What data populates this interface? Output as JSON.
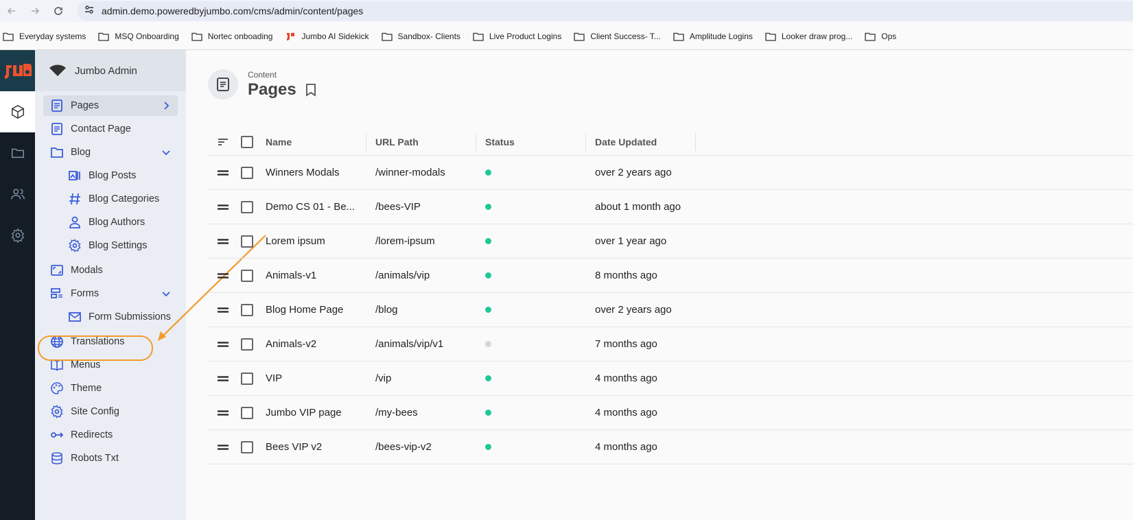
{
  "browser": {
    "url": "admin.demo.poweredbyjumbo.com/cms/admin/content/pages",
    "bookmarks": [
      {
        "label": "Everyday systems",
        "icon": "folder-icon"
      },
      {
        "label": "MSQ Onboarding",
        "icon": "folder-icon"
      },
      {
        "label": "Nortec onboading",
        "icon": "folder-icon"
      },
      {
        "label": "Jumbo AI Sidekick",
        "icon": "jumbo-logo-icon"
      },
      {
        "label": "Sandbox- Clients",
        "icon": "folder-icon"
      },
      {
        "label": "Live Product Logins",
        "icon": "folder-icon"
      },
      {
        "label": "Client Success- T...",
        "icon": "folder-icon"
      },
      {
        "label": "Amplitude Logins",
        "icon": "folder-icon"
      },
      {
        "label": "Looker draw prog...",
        "icon": "folder-icon"
      },
      {
        "label": "Ops",
        "icon": "folder-icon"
      }
    ]
  },
  "sidebar": {
    "workspace": "Jumbo Admin",
    "items": {
      "pages": "Pages",
      "contact": "Contact Page",
      "blog": "Blog",
      "blog_posts": "Blog Posts",
      "blog_categories": "Blog Categories",
      "blog_authors": "Blog Authors",
      "blog_settings": "Blog Settings",
      "modals": "Modals",
      "forms": "Forms",
      "form_submissions": "Form Submissions",
      "translations": "Translations",
      "menus": "Menus",
      "theme": "Theme",
      "site_config": "Site Config",
      "redirects": "Redirects",
      "robots": "Robots Txt"
    }
  },
  "header": {
    "breadcrumb": "Content",
    "title": "Pages"
  },
  "table": {
    "columns": {
      "name": "Name",
      "url": "URL Path",
      "status": "Status",
      "date": "Date Updated"
    },
    "rows": [
      {
        "name": "Winners Modals",
        "url": "/winner-modals",
        "published": true,
        "date": "over 2 years ago"
      },
      {
        "name": "Demo CS 01 - Be...",
        "url": "/bees-VIP",
        "published": true,
        "date": "about 1 month ago"
      },
      {
        "name": "Lorem ipsum",
        "url": "/lorem-ipsum",
        "published": true,
        "date": "over 1 year ago"
      },
      {
        "name": "Animals-v1",
        "url": "/animals/vip",
        "published": true,
        "date": "8 months ago"
      },
      {
        "name": "Blog Home Page",
        "url": "/blog",
        "published": true,
        "date": "over 2 years ago"
      },
      {
        "name": "Animals-v2",
        "url": "/animals/vip/v1",
        "published": false,
        "date": "7 months ago"
      },
      {
        "name": "VIP",
        "url": "/vip",
        "published": true,
        "date": "4 months ago"
      },
      {
        "name": "Jumbo VIP page",
        "url": "/my-bees",
        "published": true,
        "date": "4 months ago"
      },
      {
        "name": "Bees VIP v2",
        "url": "/bees-vip-v2",
        "published": true,
        "date": "4 months ago"
      }
    ]
  },
  "colors": {
    "accent_blue": "#3b5bdb",
    "status_green": "#20c997",
    "status_gray": "#cfd6df",
    "annotation_orange": "#f39a2b",
    "rail_bg": "#141d26"
  }
}
